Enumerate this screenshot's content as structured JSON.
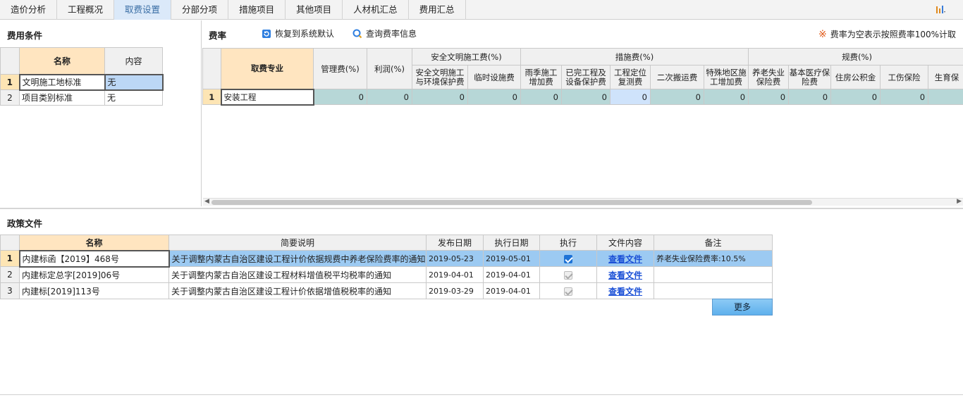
{
  "tabs": [
    {
      "label": "造价分析",
      "active": false
    },
    {
      "label": "工程概况",
      "active": false
    },
    {
      "label": "取费设置",
      "active": true
    },
    {
      "label": "分部分项",
      "active": false
    },
    {
      "label": "措施项目",
      "active": false
    },
    {
      "label": "其他项目",
      "active": false
    },
    {
      "label": "人材机汇总",
      "active": false
    },
    {
      "label": "费用汇总",
      "active": false
    }
  ],
  "fee_conditions": {
    "title": "费用条件",
    "col_name": "名称",
    "col_content": "内容",
    "rows": [
      {
        "num": "1",
        "name": "文明施工地标准",
        "content": "无"
      },
      {
        "num": "2",
        "name": "项目类别标准",
        "content": "无"
      }
    ]
  },
  "fee_rate": {
    "title": "费率",
    "restore_label": "恢复到系统默认",
    "query_label": "查询费率信息",
    "note": "费率为空表示按照费率100%计取",
    "headers": {
      "major": "取费专业",
      "mgmt": "管理费(%)",
      "profit": "利润(%)",
      "safety_group": "安全文明施工费(%)",
      "safety_env": "安全文明施工与环境保护费",
      "temp": "临时设施费",
      "measures_group": "措施费(%)",
      "rain": "雨季施工增加费",
      "done_protect": "已完工程及设备保护费",
      "locate": "工程定位复测费",
      "second_move": "二次搬运费",
      "special": "特殊地区施工增加费",
      "regs_group": "规费(%)",
      "pension": "养老失业保险费",
      "medical": "基本医疗保险费",
      "housing": "住房公积金",
      "injury": "工伤保险",
      "birth": "生育保"
    },
    "rows": [
      {
        "num": "1",
        "major": "安装工程",
        "values": [
          "0",
          "0",
          "0",
          "0",
          "0",
          "0",
          "0",
          "0",
          "0",
          "0",
          "0",
          "0",
          "0"
        ]
      }
    ]
  },
  "policy": {
    "title": "政策文件",
    "headers": [
      "名称",
      "简要说明",
      "发布日期",
      "执行日期",
      "执行",
      "文件内容",
      "备注"
    ],
    "rows": [
      {
        "num": "1",
        "name": "内建标函【2019】468号",
        "desc": "关于调整内蒙古自治区建设工程计价依据规费中养老保险费率的通知",
        "pub": "2019-05-23",
        "exec": "2019-05-01",
        "checked": true,
        "link": "查看文件",
        "note": "养老失业保险费率:10.5%"
      },
      {
        "num": "2",
        "name": "内建标定总字[2019]06号",
        "desc": "关于调整内蒙古自治区建设工程材料增值税平均税率的通知",
        "pub": "2019-04-01",
        "exec": "2019-04-01",
        "checked": false,
        "link": "查看文件",
        "note": ""
      },
      {
        "num": "3",
        "name": "内建标[2019]113号",
        "desc": "关于调整内蒙古自治区建设工程计价依据增值税税率的通知",
        "pub": "2019-03-29",
        "exec": "2019-04-01",
        "checked": false,
        "link": "查看文件",
        "note": ""
      }
    ],
    "more_label": "更多"
  }
}
